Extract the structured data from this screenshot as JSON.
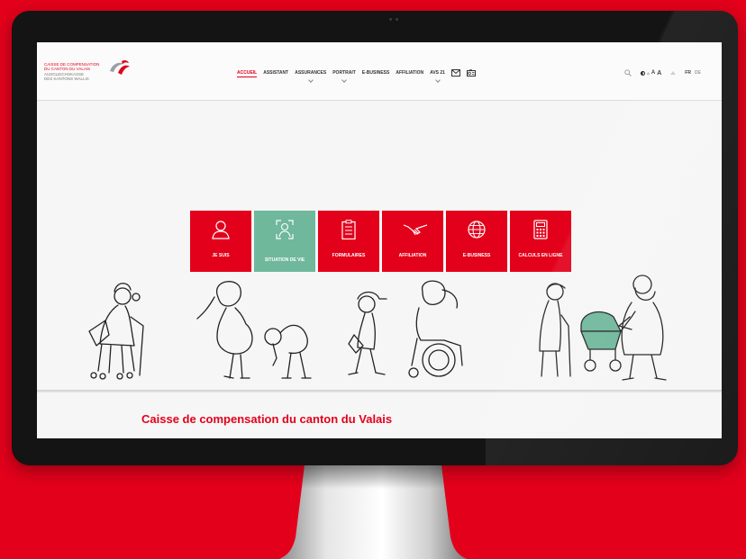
{
  "logo": {
    "lines": [
      "CAISSE DE COMPENSATION",
      "DU CANTON DU VALAIS",
      "AUSGLEICHSKASSE",
      "DES KANTONS WALLIS"
    ]
  },
  "nav": {
    "items": [
      {
        "label": "ACCUEIL",
        "active": true,
        "dropdown": false
      },
      {
        "label": "ASSISTANT",
        "active": false,
        "dropdown": false
      },
      {
        "label": "ASSURANCES",
        "active": false,
        "dropdown": true
      },
      {
        "label": "PORTRAIT",
        "active": false,
        "dropdown": true
      },
      {
        "label": "E-BUSINESS",
        "active": false,
        "dropdown": false
      },
      {
        "label": "AFFILIATION",
        "active": false,
        "dropdown": false
      },
      {
        "label": "AVS 21",
        "active": false,
        "dropdown": true
      }
    ],
    "icons": [
      "envelope-icon",
      "radio-icon"
    ]
  },
  "tools": {
    "contrast_letters": [
      "A",
      "A",
      "A"
    ],
    "languages": [
      {
        "code": "FR",
        "active": true
      },
      {
        "code": "DE",
        "active": false
      }
    ]
  },
  "tiles": [
    {
      "label": "JE SUIS",
      "icon": "person-icon",
      "color": "#e3001b"
    },
    {
      "label": "SITUATION DE VIE",
      "icon": "face-scan-icon",
      "color": "#6fb89c"
    },
    {
      "label": "FORMULAIRES",
      "icon": "clipboard-icon",
      "color": "#e3001b"
    },
    {
      "label": "AFFILIATION",
      "icon": "handshake-icon",
      "color": "#e3001b"
    },
    {
      "label": "E-BUSINESS",
      "icon": "globe-icon",
      "color": "#e3001b"
    },
    {
      "label": "CALCULS EN LIGNE",
      "icon": "calculator-icon",
      "color": "#e3001b"
    }
  ],
  "main": {
    "heading": "Caisse de compensation du canton du Valais"
  },
  "colors": {
    "brand_red": "#e3001b",
    "active_tile_green": "#6fb89c",
    "monitor_bezel": "#141414"
  }
}
